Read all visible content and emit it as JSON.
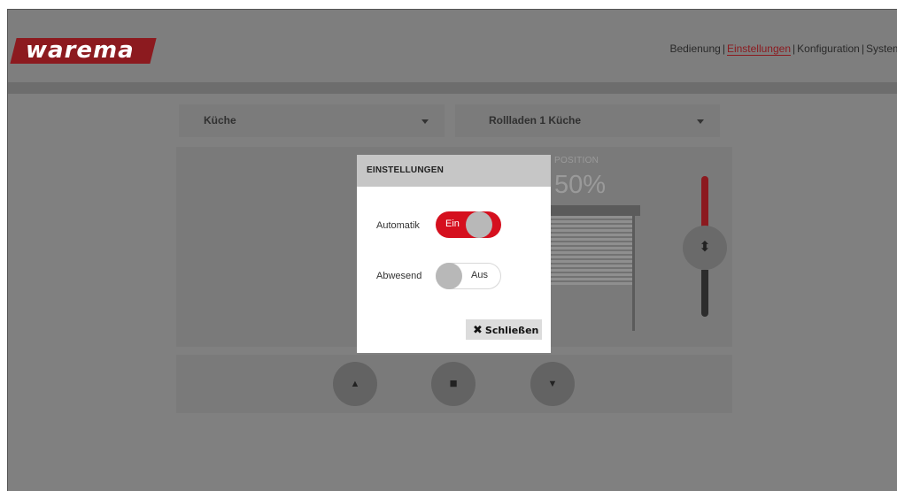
{
  "header": {
    "logo_text": "warema",
    "nav": [
      {
        "label": "Bedienung",
        "active": false
      },
      {
        "label": "Einstellungen",
        "active": true
      },
      {
        "label": "Konfiguration",
        "active": false
      },
      {
        "label": "System",
        "active": false
      }
    ],
    "separator": "|"
  },
  "selectors": {
    "room": {
      "value": "Küche"
    },
    "device": {
      "value": "Rollladen 1 Küche"
    }
  },
  "position": {
    "label": "POSITION",
    "value": "50%",
    "fraction": 0.5
  },
  "modal": {
    "title": "EINSTELLUNGEN",
    "automatik": {
      "label": "Automatik",
      "state": "Ein"
    },
    "abwesend": {
      "label": "Abwesend",
      "state": "Aus"
    },
    "close_label": "Schließen"
  },
  "icons": {
    "slider": "up-down-arrows-icon",
    "up": "arrow-up-icon",
    "stop": "stop-icon",
    "down": "arrow-down-icon",
    "close": "close-x-icon"
  },
  "colors": {
    "brand": "#8c1a1f",
    "toggle_on": "#d5101e",
    "overlay": "#808080"
  }
}
